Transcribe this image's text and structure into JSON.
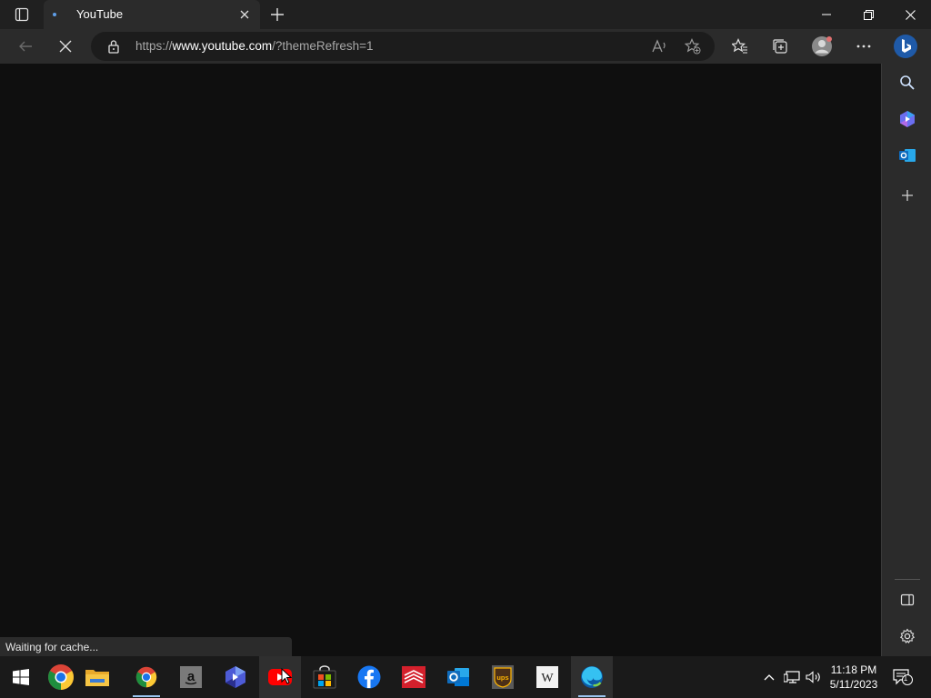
{
  "browser": {
    "tab": {
      "title": "YouTube"
    },
    "address": {
      "protocol": "https://",
      "host": "www.youtube.com",
      "path": "/?themeRefresh=1"
    },
    "status_text": "Waiting for cache...",
    "icons": {
      "tab_actions": "tab-actions-icon",
      "tab_close": "close-icon",
      "new_tab": "plus-icon",
      "back": "back-arrow-icon",
      "stop": "stop-loading-icon",
      "lock": "lock-icon",
      "read_aloud": "read-aloud-icon",
      "add_favorite": "star-plus-icon",
      "favorites": "favorites-icon",
      "collections": "collections-icon",
      "profile": "profile-avatar-icon",
      "more": "more-icon",
      "bing": "bing-icon"
    }
  },
  "sidebar": {
    "items": [
      "search-icon",
      "copilot-icon",
      "outlook-icon",
      "add-icon"
    ],
    "bottom": [
      "hide-sidebar-icon",
      "settings-icon"
    ]
  },
  "taskbar": {
    "apps": [
      "start",
      "chrome",
      "file-explorer",
      "chrome",
      "amazon",
      "power-automate",
      "youtube",
      "microsoft-store",
      "facebook",
      "bank-of-america",
      "outlook",
      "ups",
      "wikipedia",
      "edge"
    ],
    "time": "11:18 PM",
    "date": "5/11/2023",
    "notification_count": "1"
  },
  "colors": {
    "content_bg": "#0f0f0f",
    "chrome_bg": "#2b2b2b",
    "tabstrip_bg": "#202020",
    "accent": "#9cc6f0"
  }
}
